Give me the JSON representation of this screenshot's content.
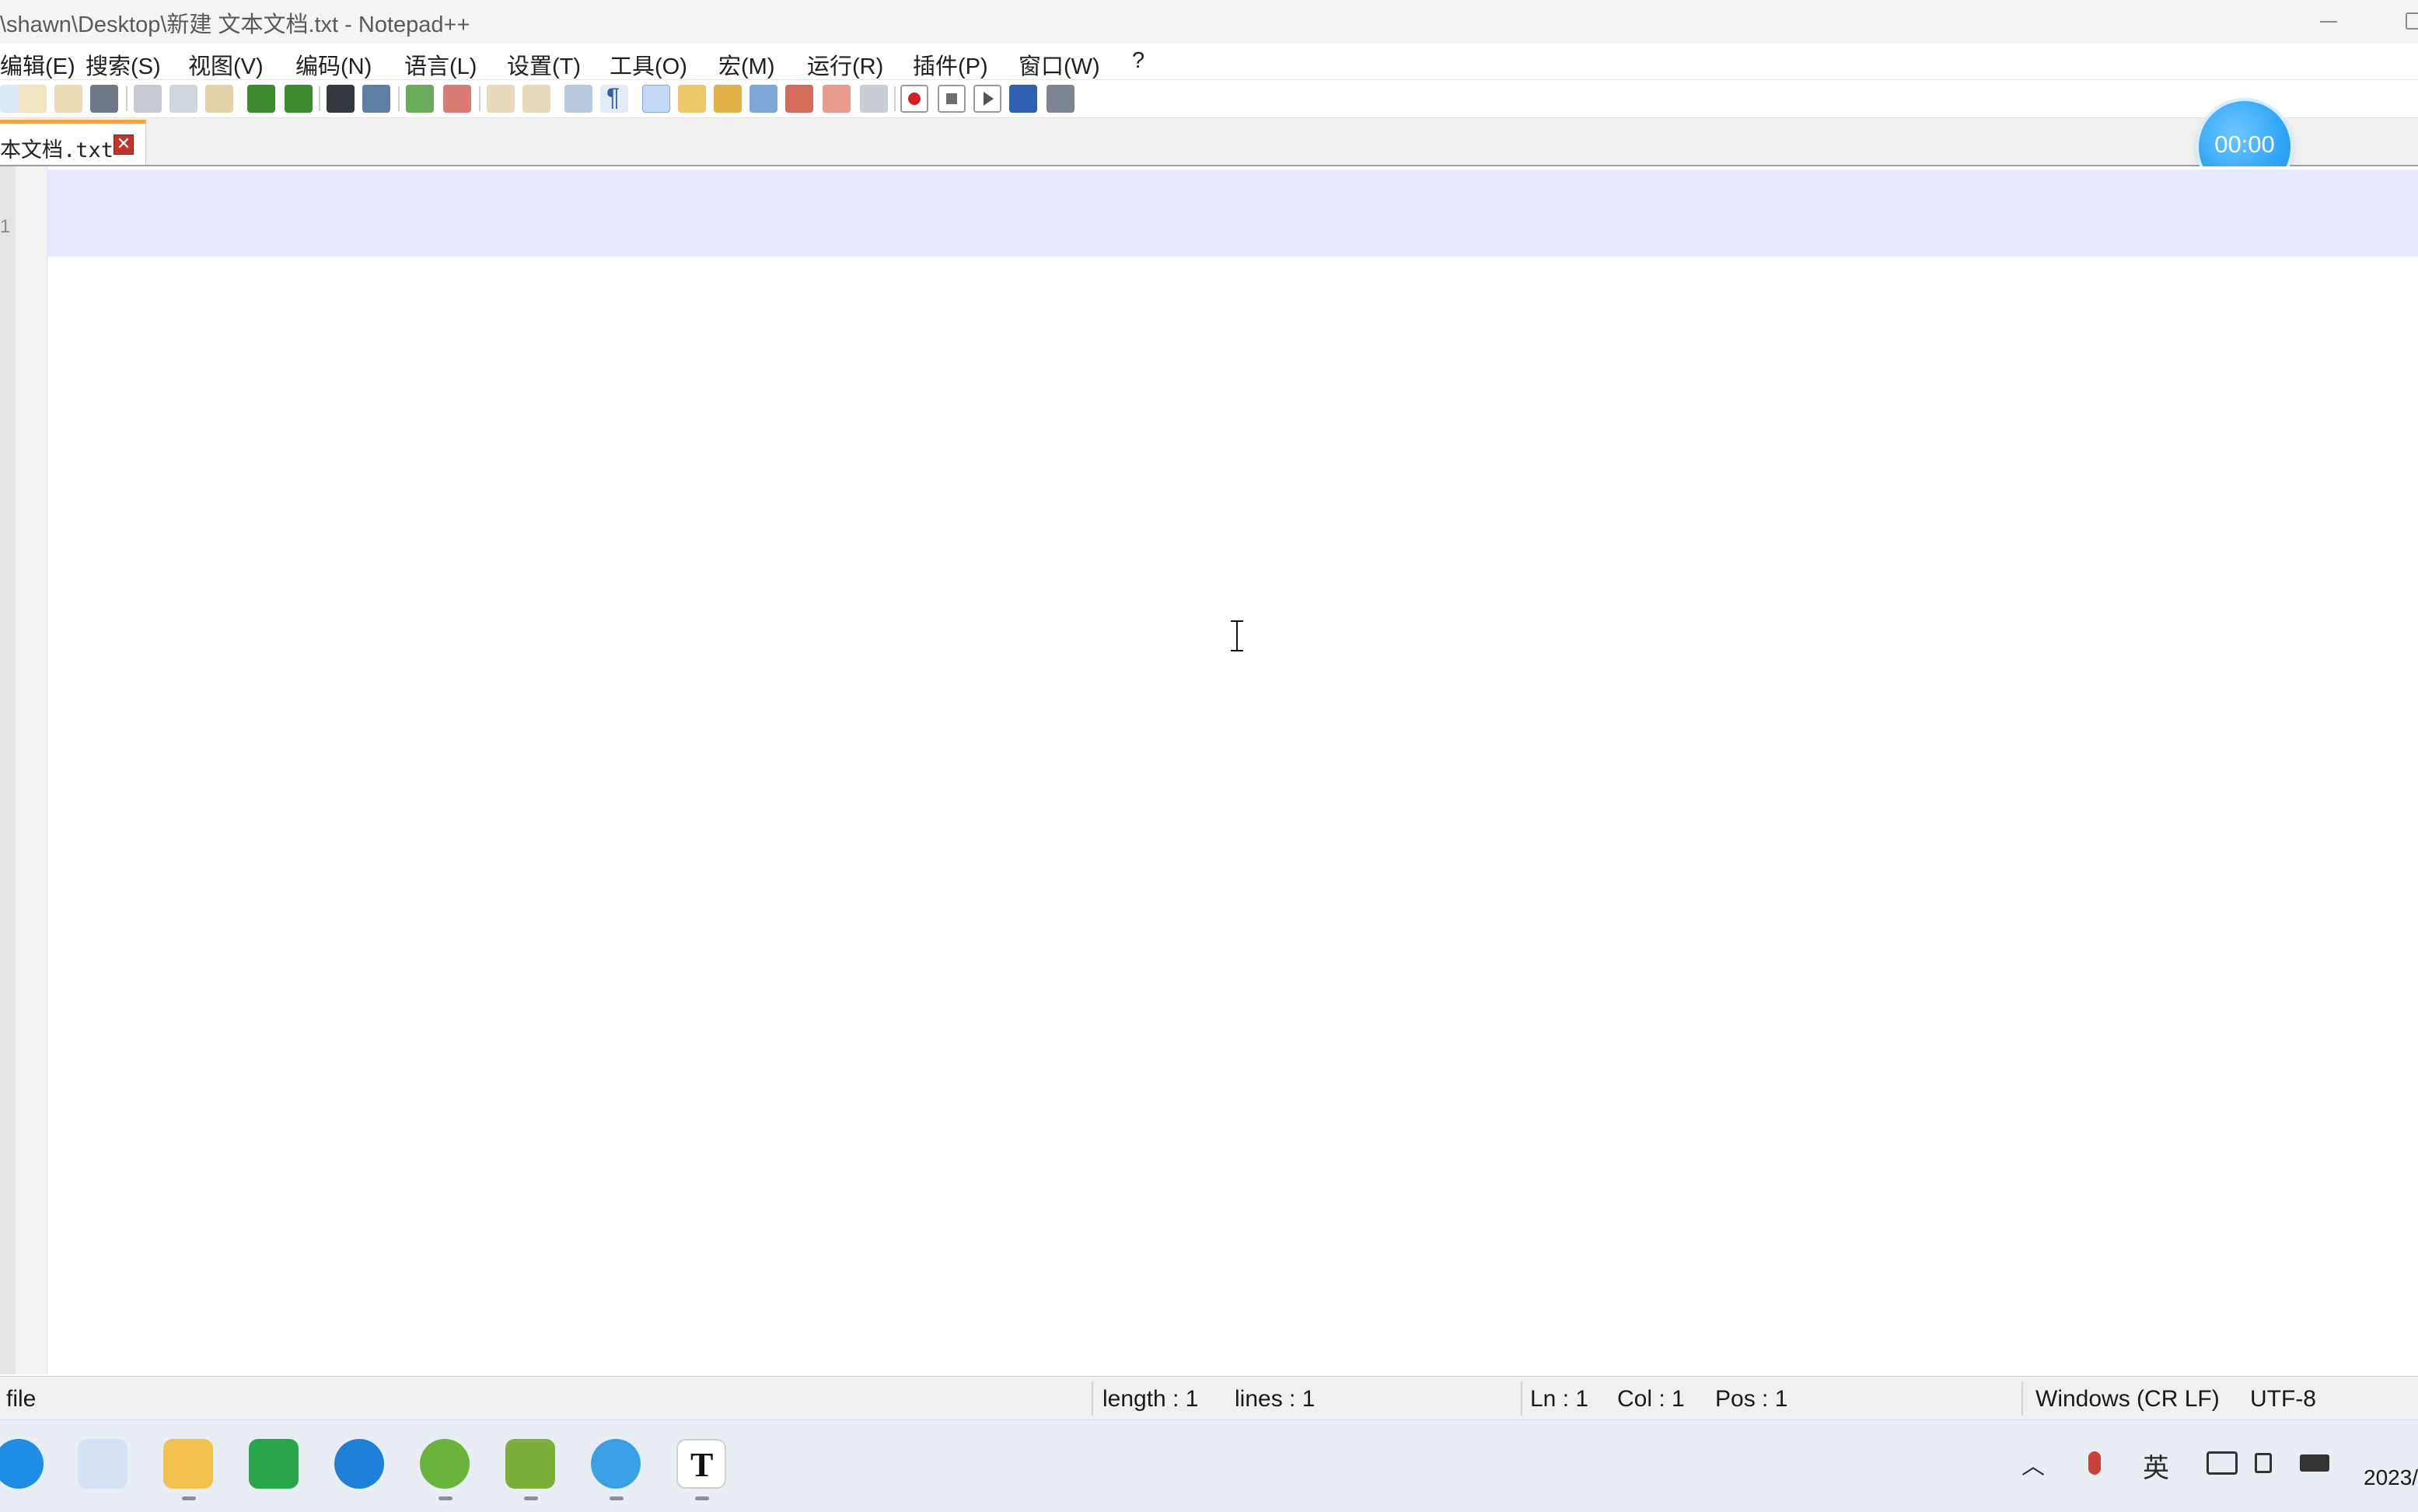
{
  "window": {
    "title": "\\shawn\\Desktop\\新建 文本文档.txt - Notepad++"
  },
  "menu": [
    {
      "label": "编辑(E)"
    },
    {
      "label": "搜索(S)"
    },
    {
      "label": "视图(V)"
    },
    {
      "label": "编码(N)"
    },
    {
      "label": "语言(L)"
    },
    {
      "label": "设置(T)"
    },
    {
      "label": "工具(O)"
    },
    {
      "label": "宏(M)"
    },
    {
      "label": "运行(R)"
    },
    {
      "label": "插件(P)"
    },
    {
      "label": "窗口(W)"
    },
    {
      "label": "?"
    }
  ],
  "toolbar": {
    "icons": [
      "new-file-icon",
      "open-file-icon",
      "save-icon",
      "save-all-icon",
      "close-icon",
      "close-all-icon",
      "print-icon",
      "cut-icon",
      "copy-icon",
      "paste-icon",
      "undo-icon",
      "redo-icon",
      "find-icon",
      "replace-icon",
      "zoom-in-icon",
      "zoom-out-icon",
      "sync-vertical-icon",
      "sync-horizontal-icon",
      "word-wrap-icon",
      "show-all-chars-icon",
      "indent-guide-icon",
      "user-defined-lang-icon",
      "doc-map-icon",
      "function-list-icon",
      "folder-as-workspace-icon",
      "monitoring-icon",
      "record-macro-icon",
      "stop-macro-icon",
      "play-macro-icon",
      "run-macro-multiple-icon",
      "save-macro-icon"
    ]
  },
  "tabs": [
    {
      "label": "本文档.txt",
      "active": true
    }
  ],
  "editor": {
    "line_number": "1"
  },
  "timer": {
    "text": "00:00"
  },
  "status": {
    "type": "file",
    "length": "length : 1",
    "lines": "lines : 1",
    "ln": "Ln : 1",
    "col": "Col : 1",
    "pos": "Pos : 1",
    "eol": "Windows (CR LF)",
    "encoding": "UTF-8"
  },
  "taskbar": {
    "apps": [
      "search-app-icon",
      "pinwheel-app-icon",
      "file-explorer-icon",
      "green-leaf-app-icon",
      "edge-browser-icon",
      "utorrent-icon",
      "image-editor-icon",
      "paint-icon",
      "typora-icon"
    ],
    "tray": {
      "ime": "英"
    },
    "clock": "2023/"
  },
  "colors": {
    "current_line": "#e8e8ff",
    "tab_accent": "#f5a340",
    "timer_bg": "#2ea5f5"
  }
}
